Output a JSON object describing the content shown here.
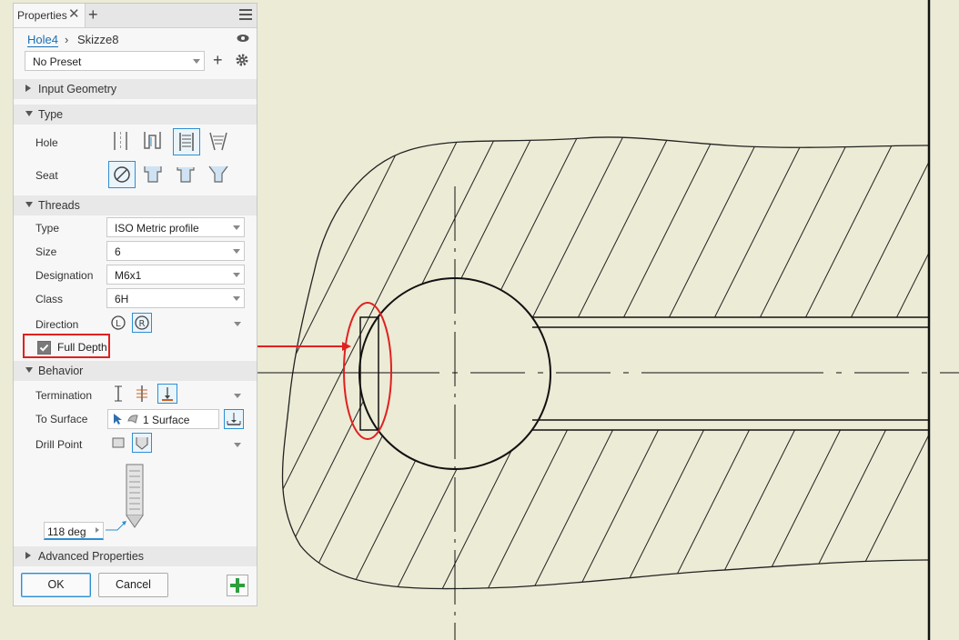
{
  "panel": {
    "tab_label": "Properties",
    "breadcrumb": {
      "link": "Hole4",
      "current": "Skizze8"
    },
    "preset": "No Preset",
    "sections": {
      "input_geometry": "Input Geometry",
      "type": "Type",
      "threads": "Threads",
      "behavior": "Behavior",
      "advanced": "Advanced Properties"
    },
    "type": {
      "hole_label": "Hole",
      "seat_label": "Seat"
    },
    "threads": {
      "type_label": "Type",
      "type_value": "ISO Metric profile",
      "size_label": "Size",
      "size_value": "6",
      "designation_label": "Designation",
      "designation_value": "M6x1",
      "class_label": "Class",
      "class_value": "6H",
      "direction_label": "Direction",
      "full_depth_label": "Full Depth",
      "full_depth_checked": true
    },
    "behavior": {
      "termination_label": "Termination",
      "to_surface_label": "To Surface",
      "to_surface_value": "1 Surface",
      "drill_point_label": "Drill Point",
      "angle_value": "118 deg"
    },
    "buttons": {
      "ok": "OK",
      "cancel": "Cancel"
    }
  },
  "colors": {
    "accent": "#2d8fd1",
    "highlight": "#e02020",
    "canvas": "#ecebd6",
    "apply_green": "#2e9e3e"
  }
}
